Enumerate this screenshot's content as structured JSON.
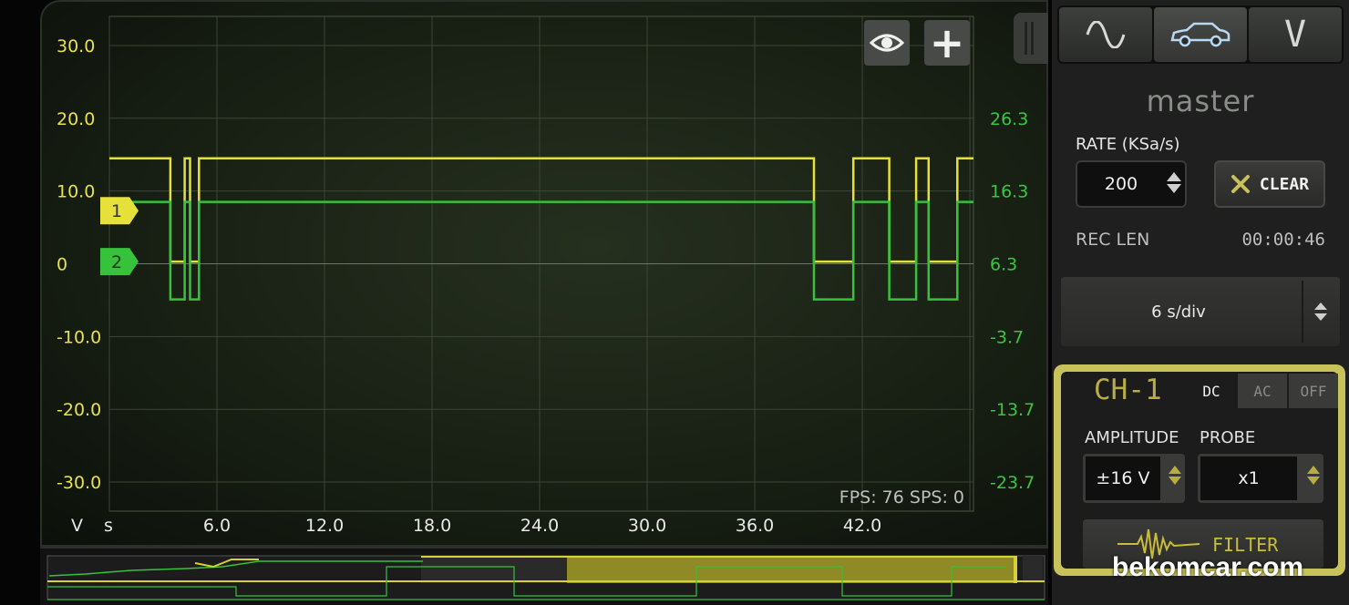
{
  "colors": {
    "ch1": "#e5e03a",
    "ch2": "#36c23a",
    "accent": "#c8c25a",
    "grid": "#3b4535"
  },
  "toolbar": {
    "eye_icon": "eye-icon",
    "plus_label": "+"
  },
  "chart_data": {
    "type": "line",
    "x": [
      0,
      3.4,
      3.4,
      4.2,
      4.2,
      4.5,
      4.5,
      5.0,
      5.0,
      5.5,
      5.5,
      39.3,
      39.3,
      41.5,
      41.5,
      43.5,
      43.5,
      45.0,
      45.0,
      45.7,
      45.7,
      47.3,
      47.3,
      48.2
    ],
    "series": [
      {
        "name": "1",
        "values": [
          14.5,
          14.5,
          0.3,
          0.3,
          14.5,
          14.5,
          0.3,
          0.3,
          14.5,
          14.5,
          14.5,
          14.5,
          0.3,
          0.3,
          14.5,
          14.5,
          0.3,
          0.3,
          14.5,
          14.5,
          0.3,
          0.3,
          14.5,
          14.5
        ]
      },
      {
        "name": "2",
        "values": [
          14.8,
          14.8,
          1.4,
          1.4,
          14.8,
          14.8,
          1.4,
          1.4,
          14.8,
          14.8,
          14.8,
          14.8,
          1.4,
          1.4,
          14.8,
          14.8,
          1.4,
          1.4,
          14.8,
          14.8,
          1.4,
          1.4,
          14.8,
          14.8
        ]
      }
    ],
    "x_ticks": [
      "6.0",
      "12.0",
      "18.0",
      "24.0",
      "30.0",
      "36.0",
      "42.0"
    ],
    "x_tick_values": [
      6,
      12,
      18,
      24,
      30,
      36,
      42
    ],
    "xlim": [
      0,
      48.2
    ],
    "xlabel": "s",
    "ylabel": "V",
    "y_left_ticks": [
      "30.0",
      "20.0",
      "10.0",
      "0",
      "-10.0",
      "-20.0",
      "-30.0"
    ],
    "y_left_tick_values": [
      30,
      20,
      10,
      0,
      -10,
      -20,
      -30
    ],
    "ylim_left": [
      -34,
      34
    ],
    "y_right_ticks": [
      "26.3",
      "16.3",
      "6.3",
      "-3.7",
      "-13.7",
      "-23.7"
    ],
    "y_right_tick_values": [
      26.3,
      16.3,
      6.3,
      -3.7,
      -13.7,
      -23.7
    ],
    "ylim_right": [
      -27.7,
      40.3
    ],
    "grid": true,
    "channel_markers": [
      {
        "label": "1",
        "level": 7.3
      },
      {
        "label": "2",
        "level": 0.3
      }
    ],
    "fps_text": "FPS: 76  SPS: 0"
  },
  "panel": {
    "mode_tabs": [
      "sine-wave-icon",
      "car-icon",
      "voltmeter-icon"
    ],
    "mode_voltmeter_label": "V",
    "master_label": "master",
    "rate_label": "RATE (KSa/s)",
    "rate_value": "200",
    "clear_label": "CLEAR",
    "reclen_label": "REC LEN",
    "reclen_value": "00:00:46",
    "timebase_value": "6 s/div"
  },
  "channel": {
    "title": "CH-1",
    "coupling": [
      "DC",
      "AC",
      "OFF"
    ],
    "coupling_selected": "DC",
    "amplitude_label": "AMPLITUDE",
    "amplitude_value": "±16 V",
    "probe_label": "PROBE",
    "probe_value": "x1",
    "filter_label": "FILTER"
  },
  "watermark": "bekomcar.com"
}
